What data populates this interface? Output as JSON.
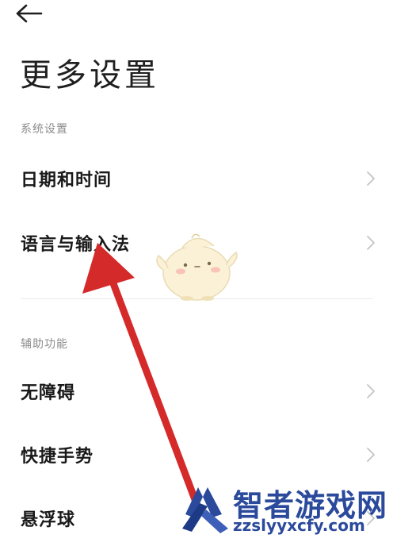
{
  "header": {
    "back_icon": "arrow-left-icon",
    "title": "更多设置"
  },
  "sections": [
    {
      "header": "系统设置",
      "items": [
        {
          "label": "日期和时间",
          "icon": "chevron-right-icon"
        },
        {
          "label": "语言与输入法",
          "icon": "chevron-right-icon"
        }
      ]
    },
    {
      "header": "辅助功能",
      "items": [
        {
          "label": "无障碍",
          "icon": "chevron-right-icon"
        },
        {
          "label": "快捷手势",
          "icon": "chevron-right-icon"
        },
        {
          "label": "悬浮球",
          "icon": "chevron-right-icon"
        }
      ]
    }
  ],
  "annotation": {
    "arrow_icon": "red-arrow-icon",
    "arrow_color": "#d42a2a",
    "mascot_icon": "chick-mascot-icon"
  },
  "watermark": {
    "title": "智者游戏网",
    "url": "zzslyyxcfy.com",
    "color": "#2b4a9c",
    "logo_icon": "watermark-logo-icon"
  },
  "colors": {
    "background": "#ffffff",
    "text_primary": "#1a1a1a",
    "text_secondary": "#8c8c8c",
    "chevron": "#c4c4c4",
    "divider": "#ececec"
  }
}
